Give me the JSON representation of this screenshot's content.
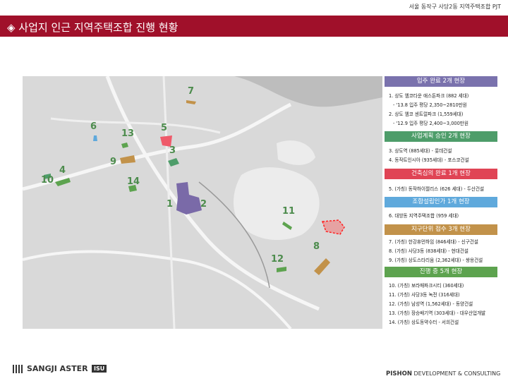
{
  "header": {
    "project": "서울 동작구 사당2동 지역주택조합 PJT"
  },
  "title": "◈ 사업지 인근 지역주택조합 진행 현황",
  "map": {
    "labels": [
      {
        "num": "1"
      },
      {
        "num": "2"
      },
      {
        "num": "3"
      },
      {
        "num": "4"
      },
      {
        "num": "5"
      },
      {
        "num": "6"
      },
      {
        "num": "7"
      },
      {
        "num": "8"
      },
      {
        "num": "9"
      },
      {
        "num": "10"
      },
      {
        "num": "11"
      },
      {
        "num": "12"
      },
      {
        "num": "13"
      },
      {
        "num": "14"
      }
    ]
  },
  "panel": {
    "sections": [
      {
        "heading": "입주 완료  2개 현장",
        "color": "#7a72ad",
        "items": [
          "1. 상도 엠코타운 애스톤파크 (882 세대)",
          "- '13.8 입주  평당 2,350~2810만원",
          "2. 상도 엠코 센트럴파크 (1,559세대)",
          "- '12.9 입주  평당 2,400~3,000만원"
        ]
      },
      {
        "heading": "사업계획 승인  2개 현장",
        "color": "#4e9d6a",
        "items": [
          "3. 상도역 (885세대) - 롯데건설",
          "4. 동작트인시아 (935세대) - 포스코건설"
        ]
      },
      {
        "heading": "건축심의 완료  1개 현장",
        "color": "#e04455",
        "items": [
          "5. (가칭) 동작하이젤리스 (626 세대) - 두산건설"
        ]
      },
      {
        "heading": "조합설립인가  1개 현장",
        "color": "#5fa9dc",
        "items": [
          "6. 대방동 지역주택조합 (959 세대)"
        ]
      },
      {
        "heading": "지구단위 접수  3개 현장",
        "color": "#c2924a",
        "items": [
          "7. (가칭) 한강휴먼하임 (846세대) - 신구건설",
          "8. (가칭) 사당3동 (838세대) - 현대건설",
          "9. (가칭) 상도스타리움 (2,362세대) - 쌍용건설"
        ]
      },
      {
        "heading": "진행 중  5개 현장",
        "color": "#5da34f",
        "items": [
          "10. (가칭) 보라매파크시티 (360세대)",
          "11. (가칭) 사당3동 녹전 (316세대)",
          "12. (가칭) 남성역 (1,562세대) - 동양건설",
          "13. (가칭) 장승배기역 (303세대) - 대우산업개발",
          "14. (가칭) 상도동약수터 - 서희건설"
        ]
      }
    ]
  },
  "footer": {
    "logo_main": "SANGJI ASTER",
    "logo_suffix": "ISU",
    "right_bold": "PISHON",
    "right_rest": " DEVELOPMENT & CONSULTING"
  }
}
